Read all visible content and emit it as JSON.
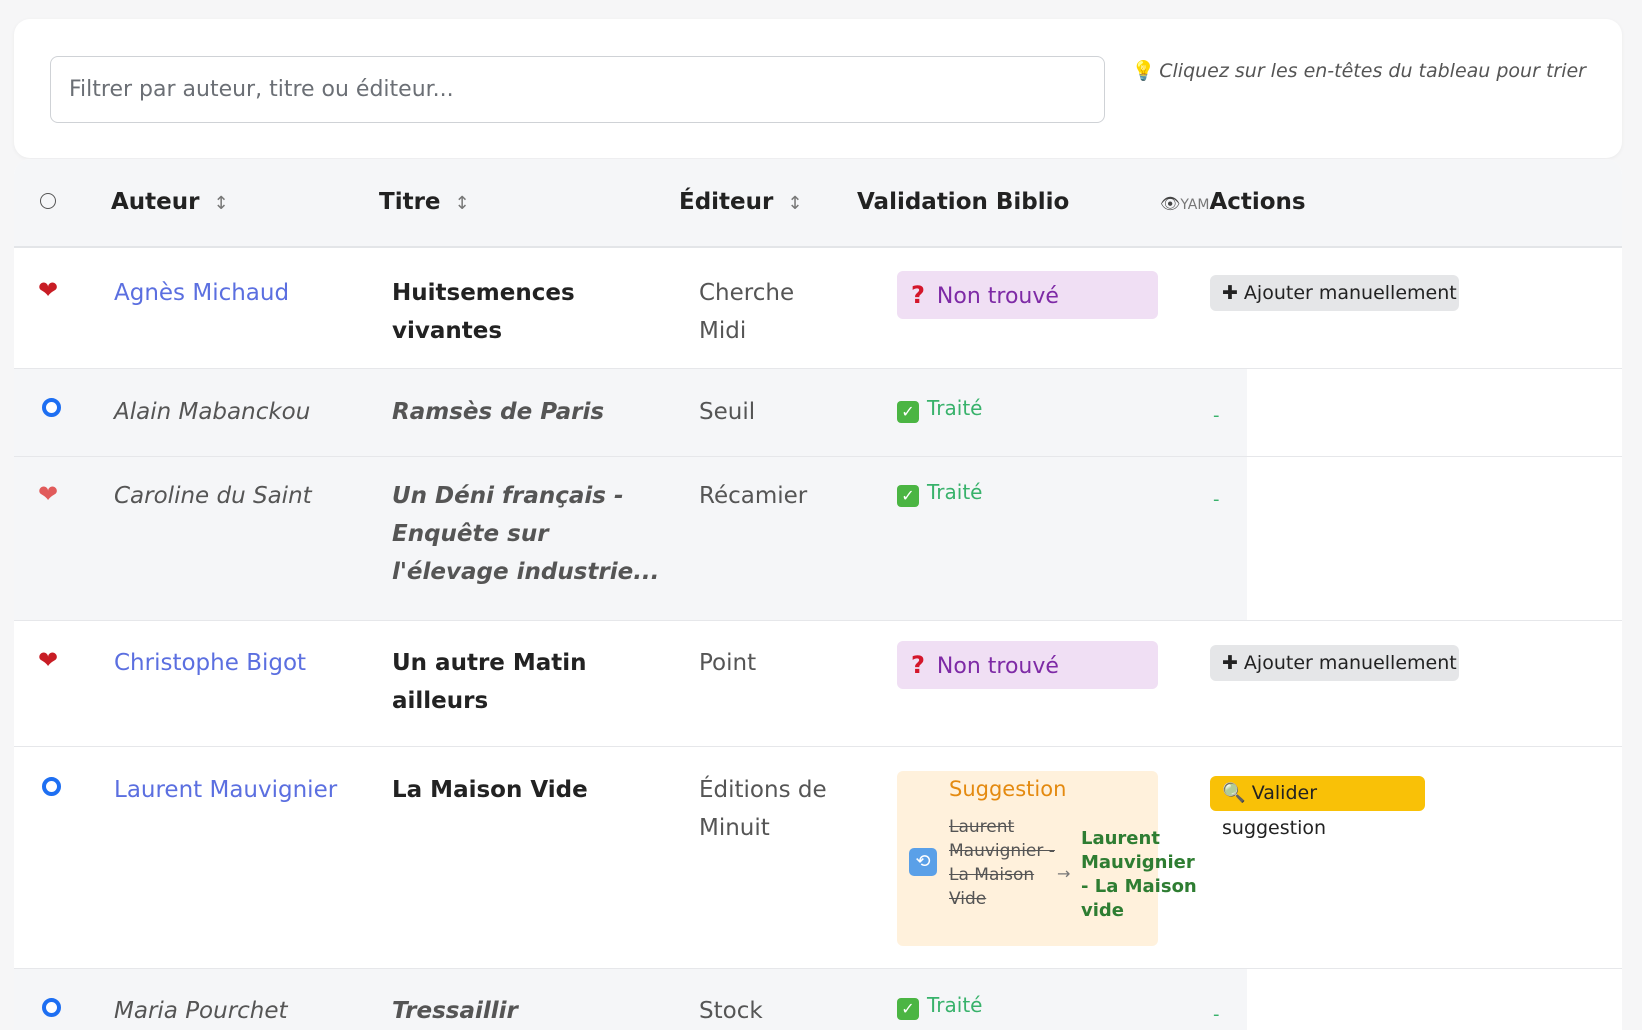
{
  "filter": {
    "placeholder": "Filtrer par auteur, titre ou éditeur..."
  },
  "hint": {
    "icon": "lightbulb-icon",
    "text": "Cliquez sur les en-têtes du tableau pour trier"
  },
  "table": {
    "headers": {
      "author": "Auteur",
      "title": "Titre",
      "publisher": "Éditeur",
      "validation": "Validation Biblio",
      "yam": "YAM",
      "actions": "Actions",
      "sort_glyph": "↕"
    },
    "rows": [
      {
        "status_icon": "heart-icon",
        "author": "Agnès Michaud",
        "title": "Huitsemences vivantes",
        "publisher": "Cherche Midi",
        "validation": "Non trouvé",
        "action": "Ajouter manuellement"
      },
      {
        "status_icon": "circle-icon",
        "author": "Alain Mabanckou",
        "title": "Ramsès de Paris",
        "publisher": "Seuil",
        "validation": "Traité",
        "action": "-"
      },
      {
        "status_icon": "heart-icon",
        "author": "Caroline du Saint",
        "title": "Un Déni français - Enquête sur l'élevage industrie...",
        "publisher": "Récamier",
        "validation": "Traité",
        "action": "-"
      },
      {
        "status_icon": "heart-icon",
        "author": "Christophe Bigot",
        "title": "Un autre Matin ailleurs",
        "publisher": "Point",
        "validation": "Non trouvé",
        "action": "Ajouter manuellement"
      },
      {
        "status_icon": "circle-icon",
        "author": "Laurent Mauvignier",
        "title": "La Maison Vide",
        "publisher": "Éditions de Minuit",
        "validation": "Suggestion",
        "suggestion_old": "Laurent Mauvignier - La Maison Vide",
        "suggestion_new": "Laurent Mauvignier - La Maison vide",
        "action": "Valider suggestion"
      },
      {
        "status_icon": "circle-icon",
        "author": "Maria Pourchet",
        "title": "Tressaillir",
        "publisher": "Stock",
        "validation": "Traité",
        "action": "-"
      }
    ]
  },
  "labels": {
    "not_found": "Non trouvé",
    "treated": "Traité",
    "add_manual": "Ajouter manuellement",
    "validate_suggestion": "Valider suggestion",
    "suggestion": "Suggestion",
    "arrow": "→"
  }
}
